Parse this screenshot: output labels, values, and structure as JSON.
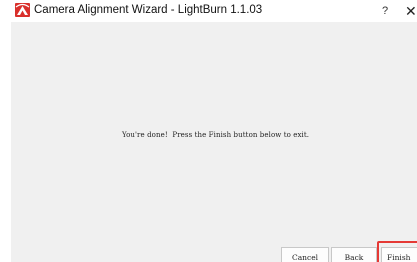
{
  "window": {
    "title": "Camera Alignment Wizard - LightBurn 1.1.03",
    "app_icon": "lightburn-logo-icon",
    "help_label": "?",
    "close_icon": "close-icon"
  },
  "main": {
    "message": "You're done!  Press the Finish button below to exit."
  },
  "buttons": {
    "cancel_label": "Cancel",
    "back_label": "Back",
    "finish_label": "Finish"
  },
  "colors": {
    "content_bg": "#f0f0f0",
    "highlight": "#e53935",
    "logo_red": "#d9302c"
  }
}
